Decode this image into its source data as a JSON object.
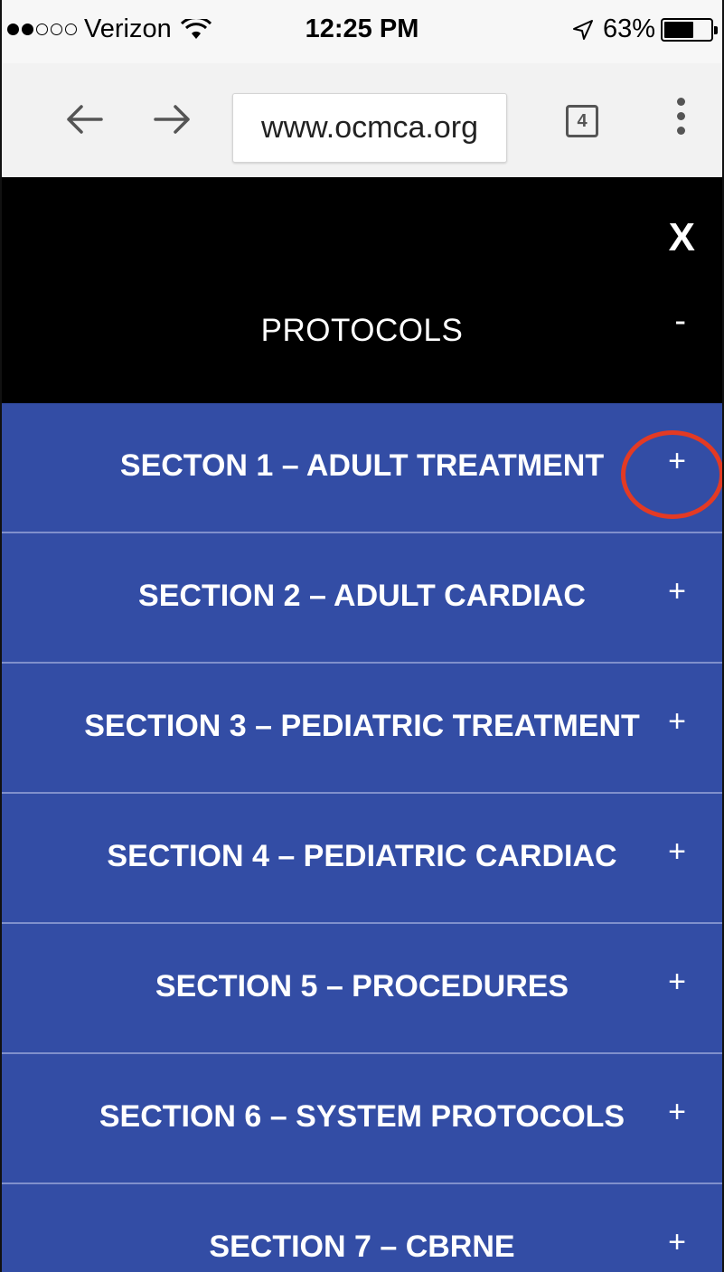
{
  "status_bar": {
    "carrier": "Verizon",
    "signal_bars_filled": 2,
    "signal_bars_total": 5,
    "time": "12:25 PM",
    "battery_percent": "63%",
    "battery_level": 0.63
  },
  "browser": {
    "url": "www.ocmca.org",
    "tab_count": "4",
    "icons": {
      "back": "arrow-left-icon",
      "forward": "arrow-right-icon",
      "menu": "kebab-menu-icon"
    }
  },
  "menu": {
    "close_label": "X",
    "heading": "PROTOCOLS",
    "collapse_label": "-",
    "sections": [
      {
        "label": "SECTON 1 – ADULT TREATMENT",
        "expand": "+"
      },
      {
        "label": "SECTION 2 – ADULT CARDIAC",
        "expand": "+"
      },
      {
        "label": "SECTION 3 – PEDIATRIC TREATMENT",
        "expand": "+"
      },
      {
        "label": "SECTION 4 – PEDIATRIC CARDIAC",
        "expand": "+"
      },
      {
        "label": "SECTION 5 – PROCEDURES",
        "expand": "+"
      },
      {
        "label": "SECTION 6 – SYSTEM PROTOCOLS",
        "expand": "+"
      },
      {
        "label": "SECTION 7 – CBRNE",
        "expand": "+"
      }
    ]
  },
  "colors": {
    "section_bg": "#334da5",
    "header_bg": "#000000",
    "highlight_ring": "#e33a24"
  }
}
